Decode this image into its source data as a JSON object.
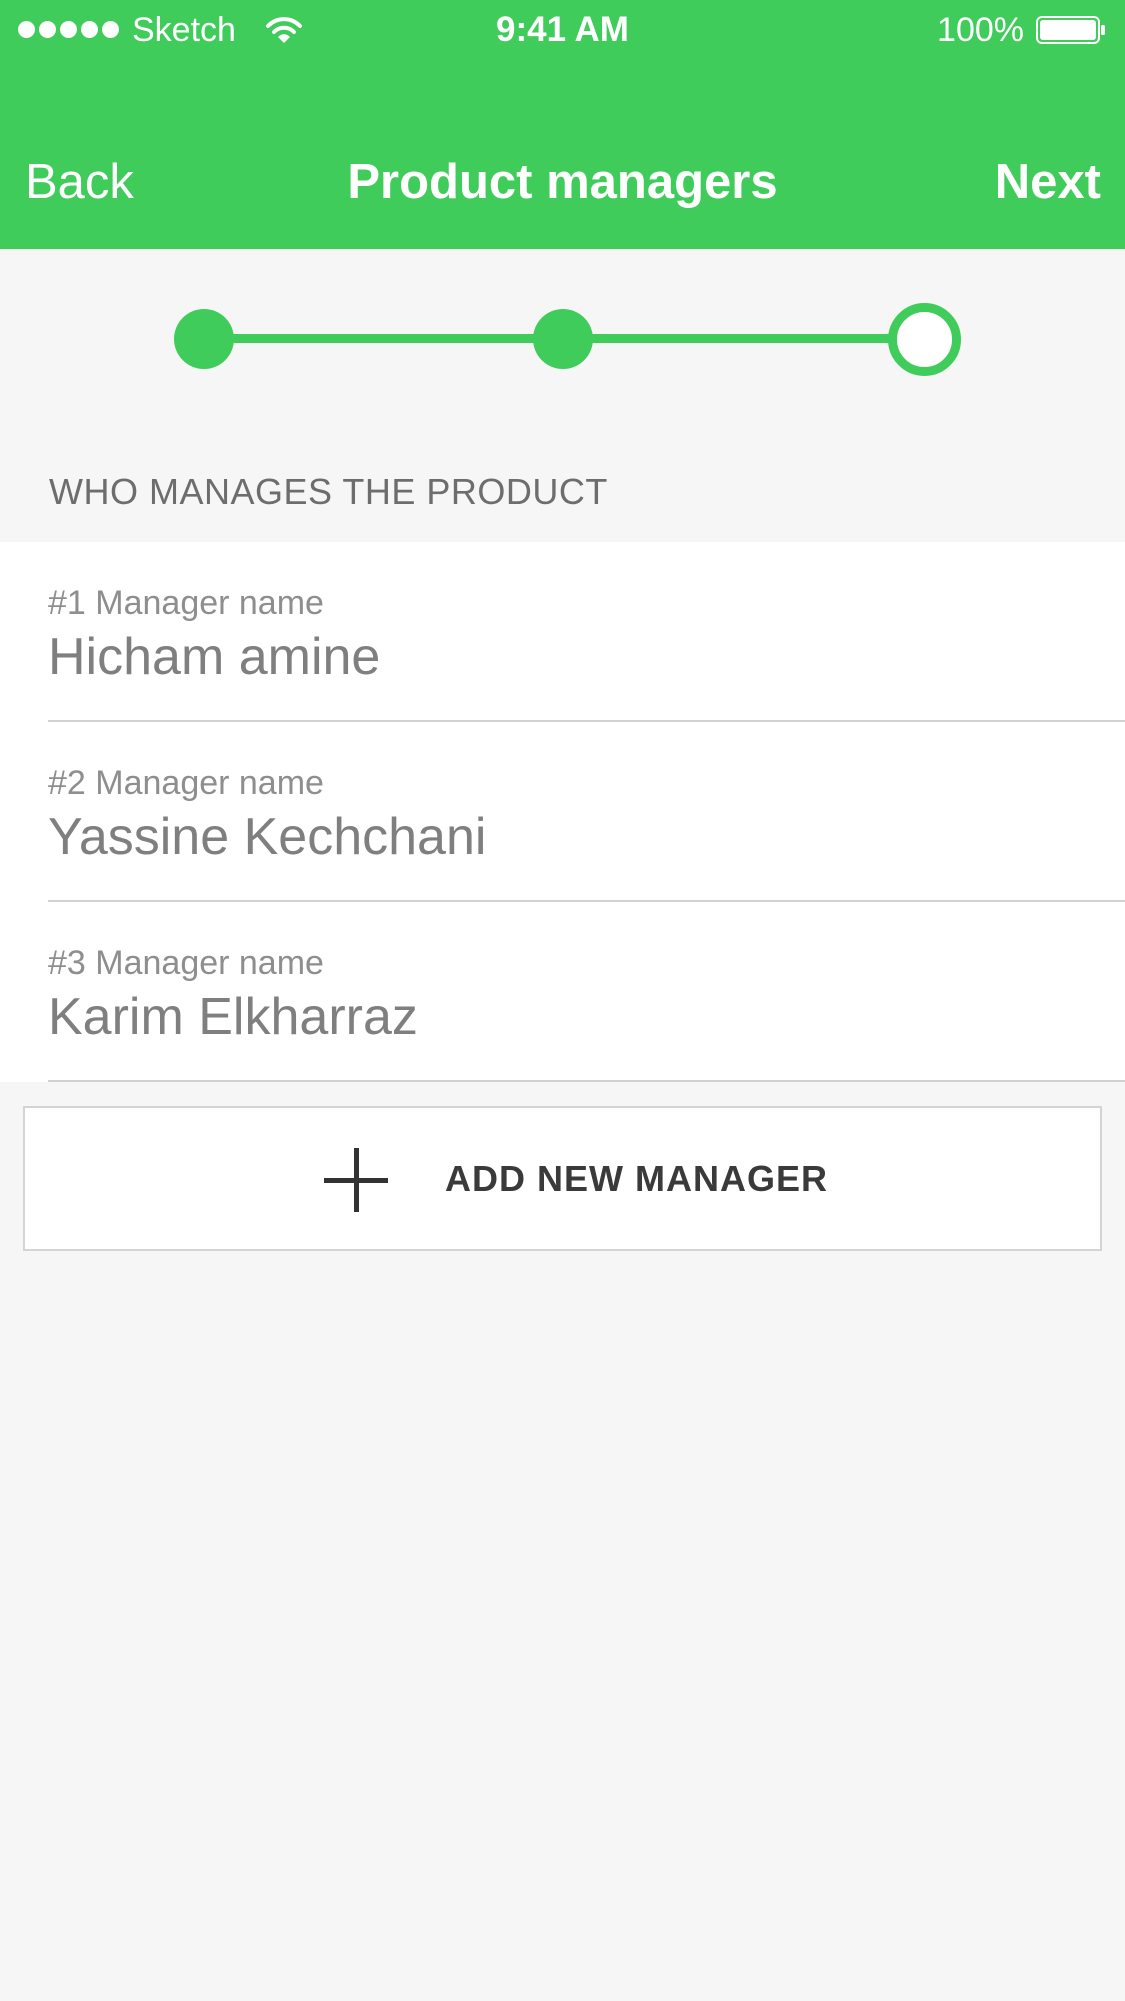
{
  "status_bar": {
    "carrier": "Sketch",
    "time": "9:41 AM",
    "battery_percent": "100%",
    "battery_level": 1.0,
    "signal_bars": 5,
    "signal_icon": "cellular-signal-dots",
    "wifi_icon": "wifi-icon",
    "battery_icon": "battery-icon"
  },
  "nav": {
    "back_label": "Back",
    "title": "Product managers",
    "next_label": "Next"
  },
  "progress": {
    "total_steps": 3,
    "current_step": 3
  },
  "section": {
    "header": "WHO MANAGES THE PRODUCT"
  },
  "managers": [
    {
      "label": "#1 Manager name",
      "value": "Hicham amine"
    },
    {
      "label": "#2 Manager name",
      "value": "Yassine Kechchani"
    },
    {
      "label": "#3 Manager name",
      "value": "Karim Elkharraz"
    }
  ],
  "add_button": {
    "label": "ADD NEW MANAGER",
    "icon": "plus-icon"
  },
  "colors": {
    "accent": "#40cc5b",
    "background": "#f6f6f6",
    "surface": "#ffffff",
    "text_secondary": "#8e8e8e",
    "divider": "#d1d1d1"
  }
}
